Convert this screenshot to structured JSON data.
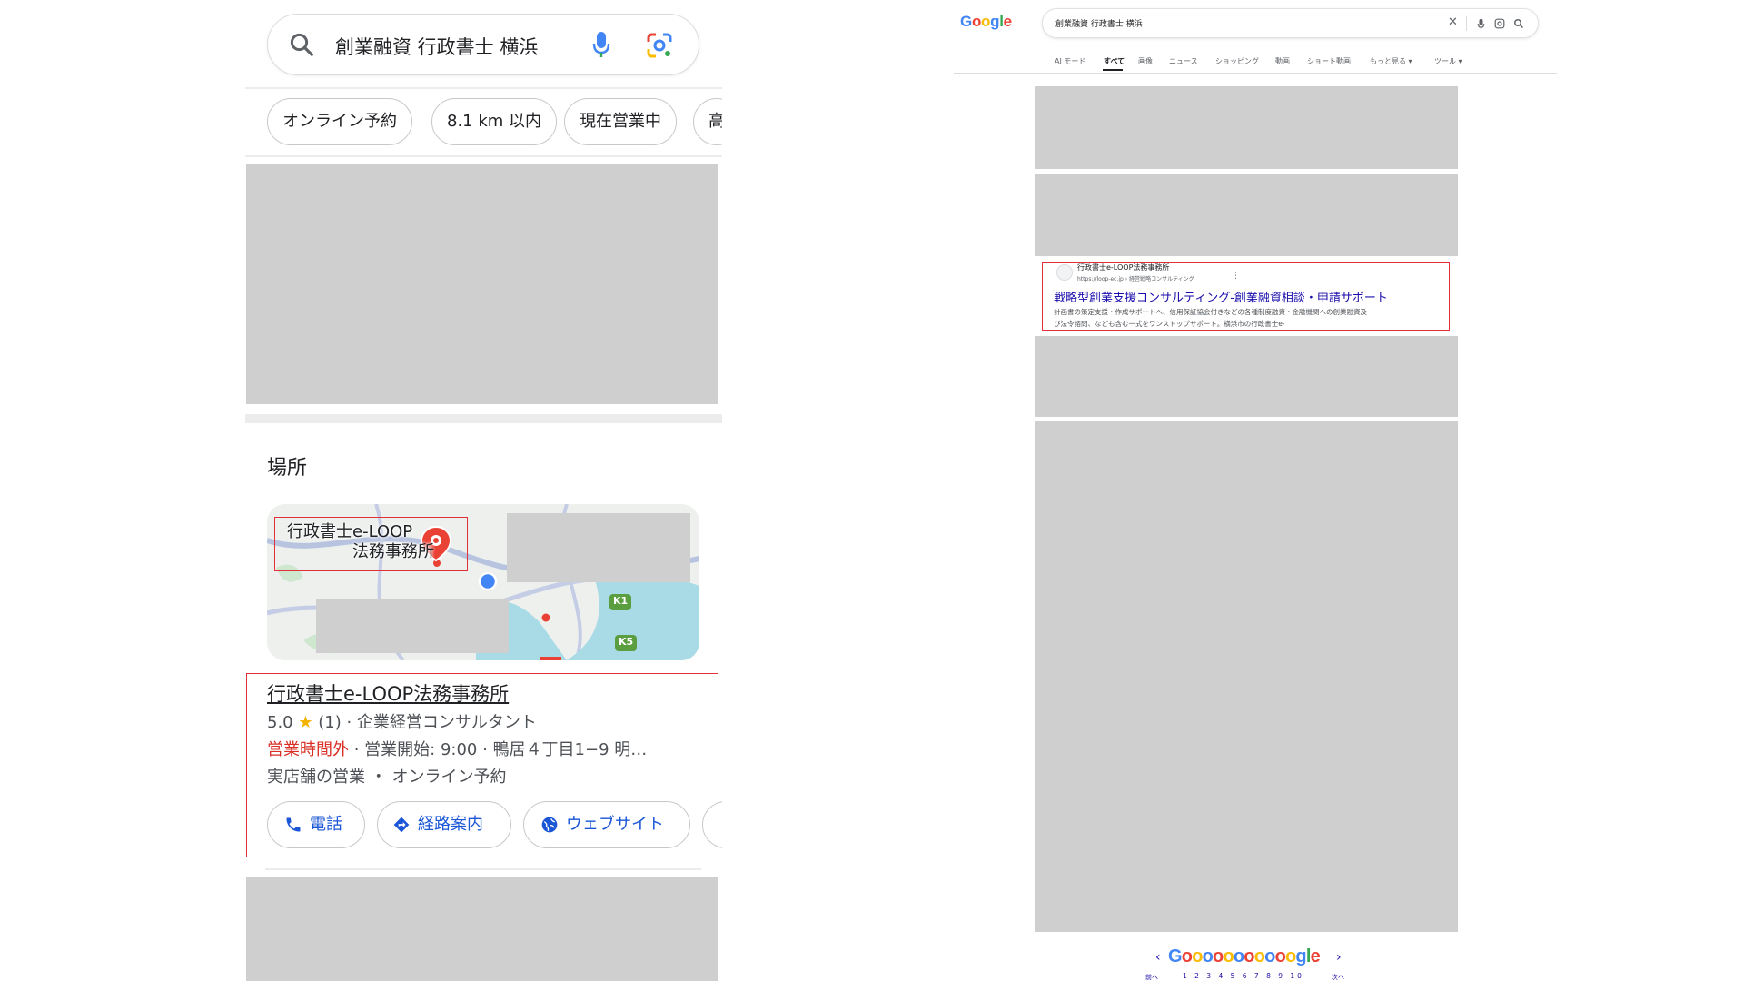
{
  "mobile": {
    "search": {
      "query": "創業融資 行政書士 横浜",
      "search_icon": "search-icon",
      "mic_icon": "mic-icon",
      "lens_icon": "lens-icon"
    },
    "chips": [
      "オンライン予約",
      "8.1 km 以内",
      "現在営業中",
      "高"
    ],
    "places": {
      "title": "場所",
      "map_label_line1": "行政書士e-LOOP",
      "map_label_line2": "法務事務所",
      "map_markers": [
        "K1",
        "K5"
      ],
      "business": {
        "name": "行政書士e-LOOP法務事務所",
        "rating": "5.0",
        "reviews": "(1)",
        "category": "企業経営コンサルタント",
        "status": "営業時間外",
        "hours": "営業開始: 9:00",
        "address": "鴨居４丁目1−9 明…",
        "services": "実店舗の営業 ・ オンライン予約",
        "sep": " · ",
        "actions": [
          {
            "label": "電話",
            "icon": "phone-icon"
          },
          {
            "label": "経路案内",
            "icon": "directions-icon"
          },
          {
            "label": "ウェブサイト",
            "icon": "globe-icon"
          }
        ]
      }
    },
    "colors": {
      "highlight": "#e0303a",
      "placeholder": "#cfcfcf",
      "link": "#1a56d6",
      "closed": "#d93025"
    }
  },
  "desktop": {
    "logo": "Google",
    "search": {
      "query": "創業融資 行政書士 横浜"
    },
    "tabs": [
      "AI モード",
      "すべて",
      "画像",
      "ニュース",
      "ショッピング",
      "動画",
      "ショート動画",
      "もっと見る ▾",
      "ツール ▾"
    ],
    "active_tab": "すべて",
    "result": {
      "site_name": "行政書士e-LOOP法務事務所",
      "url": "https://loop-ec.jp › 経営戦略コンサルティング",
      "title": "戦略型創業支援コンサルティング-創業融資相談・申請サポート",
      "snippet_line1": "計画書の策定支援・作成サポートへ、信用保証協会付きなどの各種制度融資・金融機関への創業融資及",
      "snippet_line2": "び法令諮問、なども含む一式をワンストップサポート。横浜市の行政書士e-"
    },
    "pagination": {
      "logo": "Gooooooooooogle",
      "pages": "1 2 3 4 5 6 7 8 9 10",
      "prev": "前へ",
      "next": "次へ"
    }
  }
}
